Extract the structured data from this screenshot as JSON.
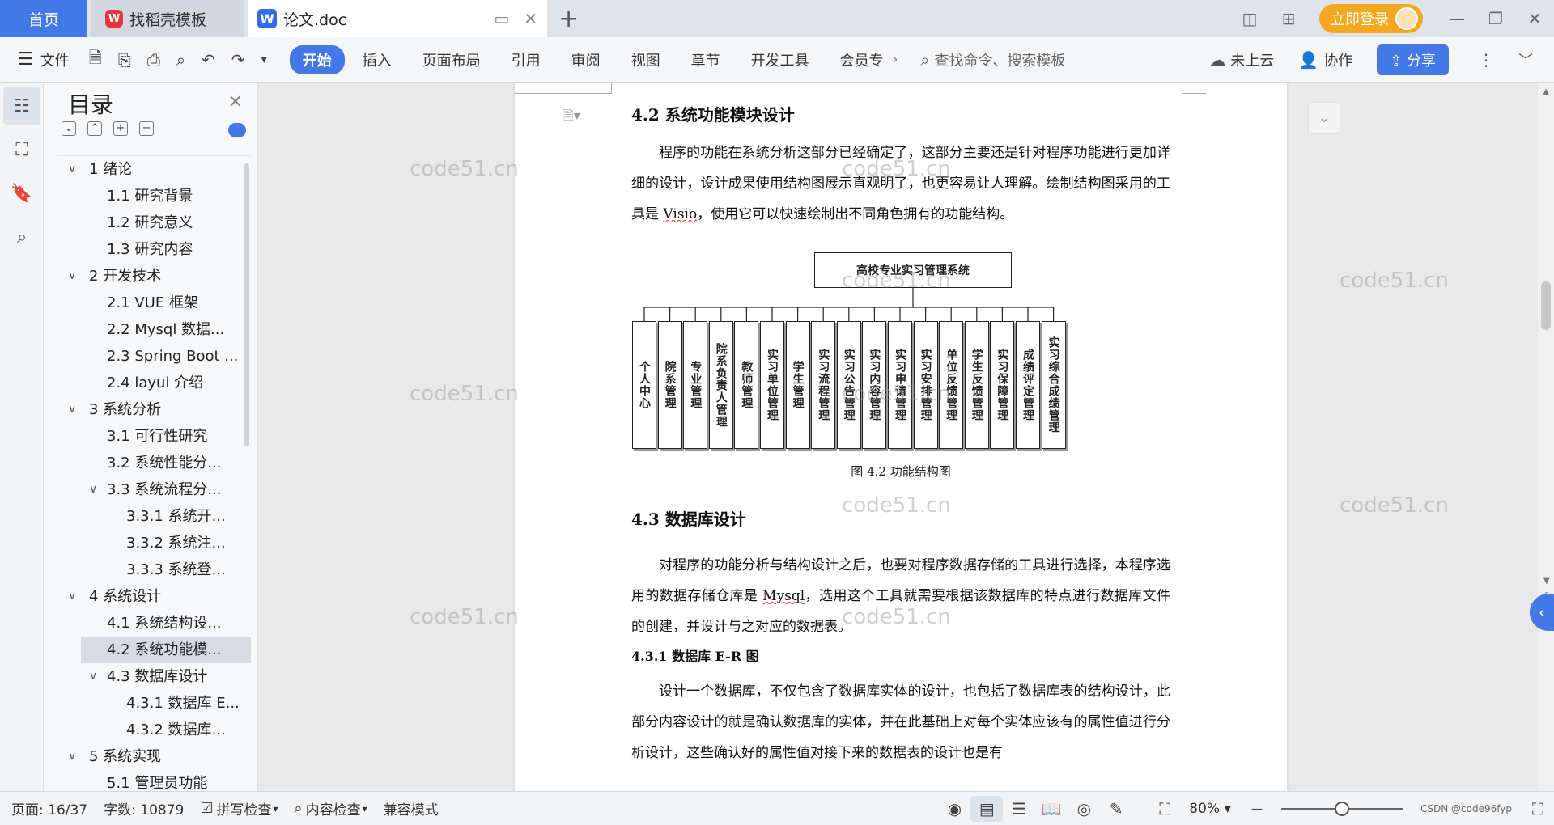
{
  "tabs": {
    "home": "首页",
    "docer": "找稻壳模板",
    "doc": "论文.doc"
  },
  "titlebar": {
    "login": "立即登录"
  },
  "toolbar": {
    "file": "文件",
    "ribbon": [
      "开始",
      "插入",
      "页面布局",
      "引用",
      "审阅",
      "视图",
      "章节",
      "开发工具",
      "会员专"
    ],
    "active_ribbon": "开始",
    "search_placeholder": "查找命令、搜索模板",
    "cloud": "未上云",
    "collab": "协作",
    "share": "分享"
  },
  "toc": {
    "title": "目录",
    "items": [
      {
        "level": 1,
        "text": "1  绪论",
        "expanded": true
      },
      {
        "level": 2,
        "text": "1.1  研究背景"
      },
      {
        "level": 2,
        "text": "1.2  研究意义"
      },
      {
        "level": 2,
        "text": "1.3  研究内容"
      },
      {
        "level": 1,
        "text": "2  开发技术",
        "expanded": true
      },
      {
        "level": 2,
        "text": "2.1 VUE 框架"
      },
      {
        "level": 2,
        "text": "2.2 Mysql 数据..."
      },
      {
        "level": 2,
        "text": "2.3 Spring Boot ..."
      },
      {
        "level": 2,
        "text": "2.4 layui 介绍"
      },
      {
        "level": 1,
        "text": "3  系统分析",
        "expanded": true
      },
      {
        "level": 2,
        "text": "3.1 可行性研究"
      },
      {
        "level": 2,
        "text": "3.2 系统性能分..."
      },
      {
        "level": 2,
        "text": "3.3  系统流程分...",
        "expanded": true
      },
      {
        "level": 3,
        "text": "3.3.1  系统开..."
      },
      {
        "level": 3,
        "text": "3.3.2  系统注..."
      },
      {
        "level": 3,
        "text": "3.3.3  系统登..."
      },
      {
        "level": 1,
        "text": "4  系统设计",
        "expanded": true
      },
      {
        "level": 2,
        "text": "4.1  系统结构设..."
      },
      {
        "level": 2,
        "text": "4.2 系统功能模...",
        "selected": true
      },
      {
        "level": 2,
        "text": "4.3 数据库设计",
        "expanded": true
      },
      {
        "level": 3,
        "text": "4.3.1 数据库 E..."
      },
      {
        "level": 3,
        "text": "4.3.2  数据库..."
      },
      {
        "level": 1,
        "text": "5  系统实现",
        "expanded": true
      },
      {
        "level": 2,
        "text": "5.1  管理员功能"
      }
    ]
  },
  "document": {
    "heading_42": "4.2 系统功能模块设计",
    "para1_a": "程序的功能在系统分析这部分已经确定了，这部分主要还是针对程序功能进行更加详细的设计，设计成果使用结构图展示直观明了，也更容易让人理解。绘制结构图采用的工具是 ",
    "para1_tool": "Visio",
    "para1_b": "，使用它可以快速绘制出不同角色拥有的功能结构。",
    "chart_root": "高校专业实习管理系统",
    "chart_modules": [
      "个人中心",
      "院系管理",
      "专业管理",
      "院系负责人管理",
      "教师管理",
      "实习单位管理",
      "学生管理",
      "实习流程管理",
      "实习公告管理",
      "实习内容管理",
      "实习申请管理",
      "实习安排管理",
      "单位反馈管理",
      "学生反馈管理",
      "实习保障管理",
      "成绩评定管理",
      "实习综合成绩管理"
    ],
    "caption": "图 4.2  功能结构图",
    "heading_43": "4.3 数据库设计",
    "para2_a": "对程序的功能分析与结构设计之后，也要对程序数据存储的工具进行选择，本程序选用的数据存储仓库是 ",
    "para2_tool": "Mysql",
    "para2_b": "，选用这个工具就需要根据该数据库的特点进行数据库文件的创建，并设计与之对应的数据表。",
    "heading_431": "4.3.1 数据库 E-R 图",
    "para3": "设计一个数据库，不仅包含了数据库实体的设计，也包括了数据库表的结构设计，此部分内容设计的就是确认数据库的实体，并在此基础上对每个实体应该有的属性值进行分析设计，这些确认好的属性值对接下来的数据表的设计也是有"
  },
  "watermark": "code51.cn",
  "status": {
    "page": "页面: 16/37",
    "words": "字数: 10879",
    "spell": "拼写检查",
    "content": "内容检查",
    "compat": "兼容模式",
    "zoom": "80%",
    "zoom_fraction": 0.5,
    "credit": "CSDN @code96fyp"
  }
}
